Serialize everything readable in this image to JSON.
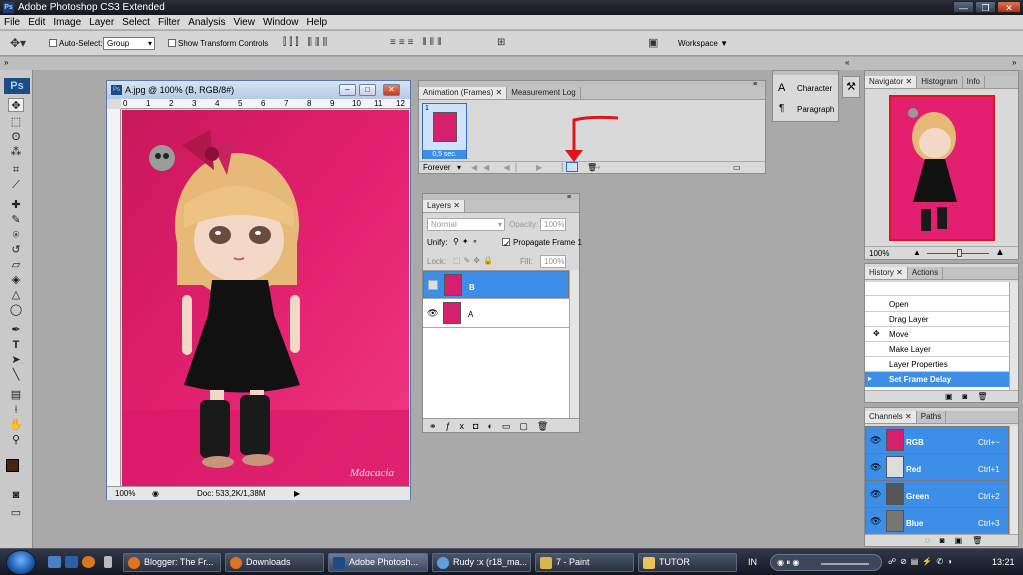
{
  "app": {
    "title": "Adobe Photoshop CS3 Extended",
    "window_buttons": [
      "—",
      "❐",
      "✕"
    ]
  },
  "menu": [
    "File",
    "Edit",
    "Image",
    "Layer",
    "Select",
    "Filter",
    "Analysis",
    "View",
    "Window",
    "Help"
  ],
  "options_bar": {
    "auto_select_label": "Auto-Select:",
    "auto_select_value": "Group",
    "show_transform_label": "Show Transform Controls",
    "workspace_label": "Workspace ▼"
  },
  "toolbox": {
    "logo": "Ps"
  },
  "document": {
    "title": "A.jpg @ 100% (B, RGB/8#)",
    "zoom": "100%",
    "doc_info": "Doc: 533,2K/1,38M",
    "ruler_marks": [
      "0",
      "1",
      "2",
      "3",
      "4",
      "5",
      "6",
      "7",
      "8",
      "9",
      "10",
      "11",
      "12"
    ],
    "watermark": "Mdacacia"
  },
  "animation_panel": {
    "tab_animation": "Animation (Frames)",
    "tab_measurement": "Measurement Log",
    "frame_number": "1",
    "frame_delay": "0,5 sec.",
    "loop": "Forever"
  },
  "layers_panel": {
    "tab": "Layers",
    "blend_mode": "Normal",
    "opacity_label": "Opacity:",
    "opacity_value": "100%",
    "unify_label": "Unify:",
    "propagate_label": "Propagate Frame 1",
    "lock_label": "Lock:",
    "fill_label": "Fill:",
    "fill_value": "100%",
    "layers": [
      {
        "name": "B",
        "selected": true,
        "visible": false
      },
      {
        "name": "A",
        "selected": false,
        "visible": true
      }
    ]
  },
  "char_panel": {
    "character": "Character",
    "paragraph": "Paragraph"
  },
  "navigator_panel": {
    "tabs": [
      "Navigator",
      "Histogram",
      "Info"
    ],
    "zoom": "100%"
  },
  "history_panel": {
    "tabs": [
      "History",
      "Actions"
    ],
    "items": [
      "Open",
      "Drag Layer",
      "Move",
      "Make Layer",
      "Layer Properties",
      "Set Frame Delay"
    ],
    "selected_index": 5
  },
  "channels_panel": {
    "tabs": [
      "Channels",
      "Paths"
    ],
    "channels": [
      {
        "name": "RGB",
        "shortcut": "Ctrl+~"
      },
      {
        "name": "Red",
        "shortcut": "Ctrl+1"
      },
      {
        "name": "Green",
        "shortcut": "Ctrl+2"
      },
      {
        "name": "Blue",
        "shortcut": "Ctrl+3"
      }
    ]
  },
  "taskbar": {
    "buttons": [
      "Blogger: The Fr...",
      "Downloads",
      "Adobe Photosh...",
      "Rudy :x (r18_ma...",
      "7 - Paint",
      "TUTOR"
    ],
    "language": "IN",
    "clock": "13:21"
  },
  "colors": {
    "selection_blue": "#3d8ee6",
    "photo_pink": "#e2206f",
    "annotation_red": "#e0141a"
  }
}
